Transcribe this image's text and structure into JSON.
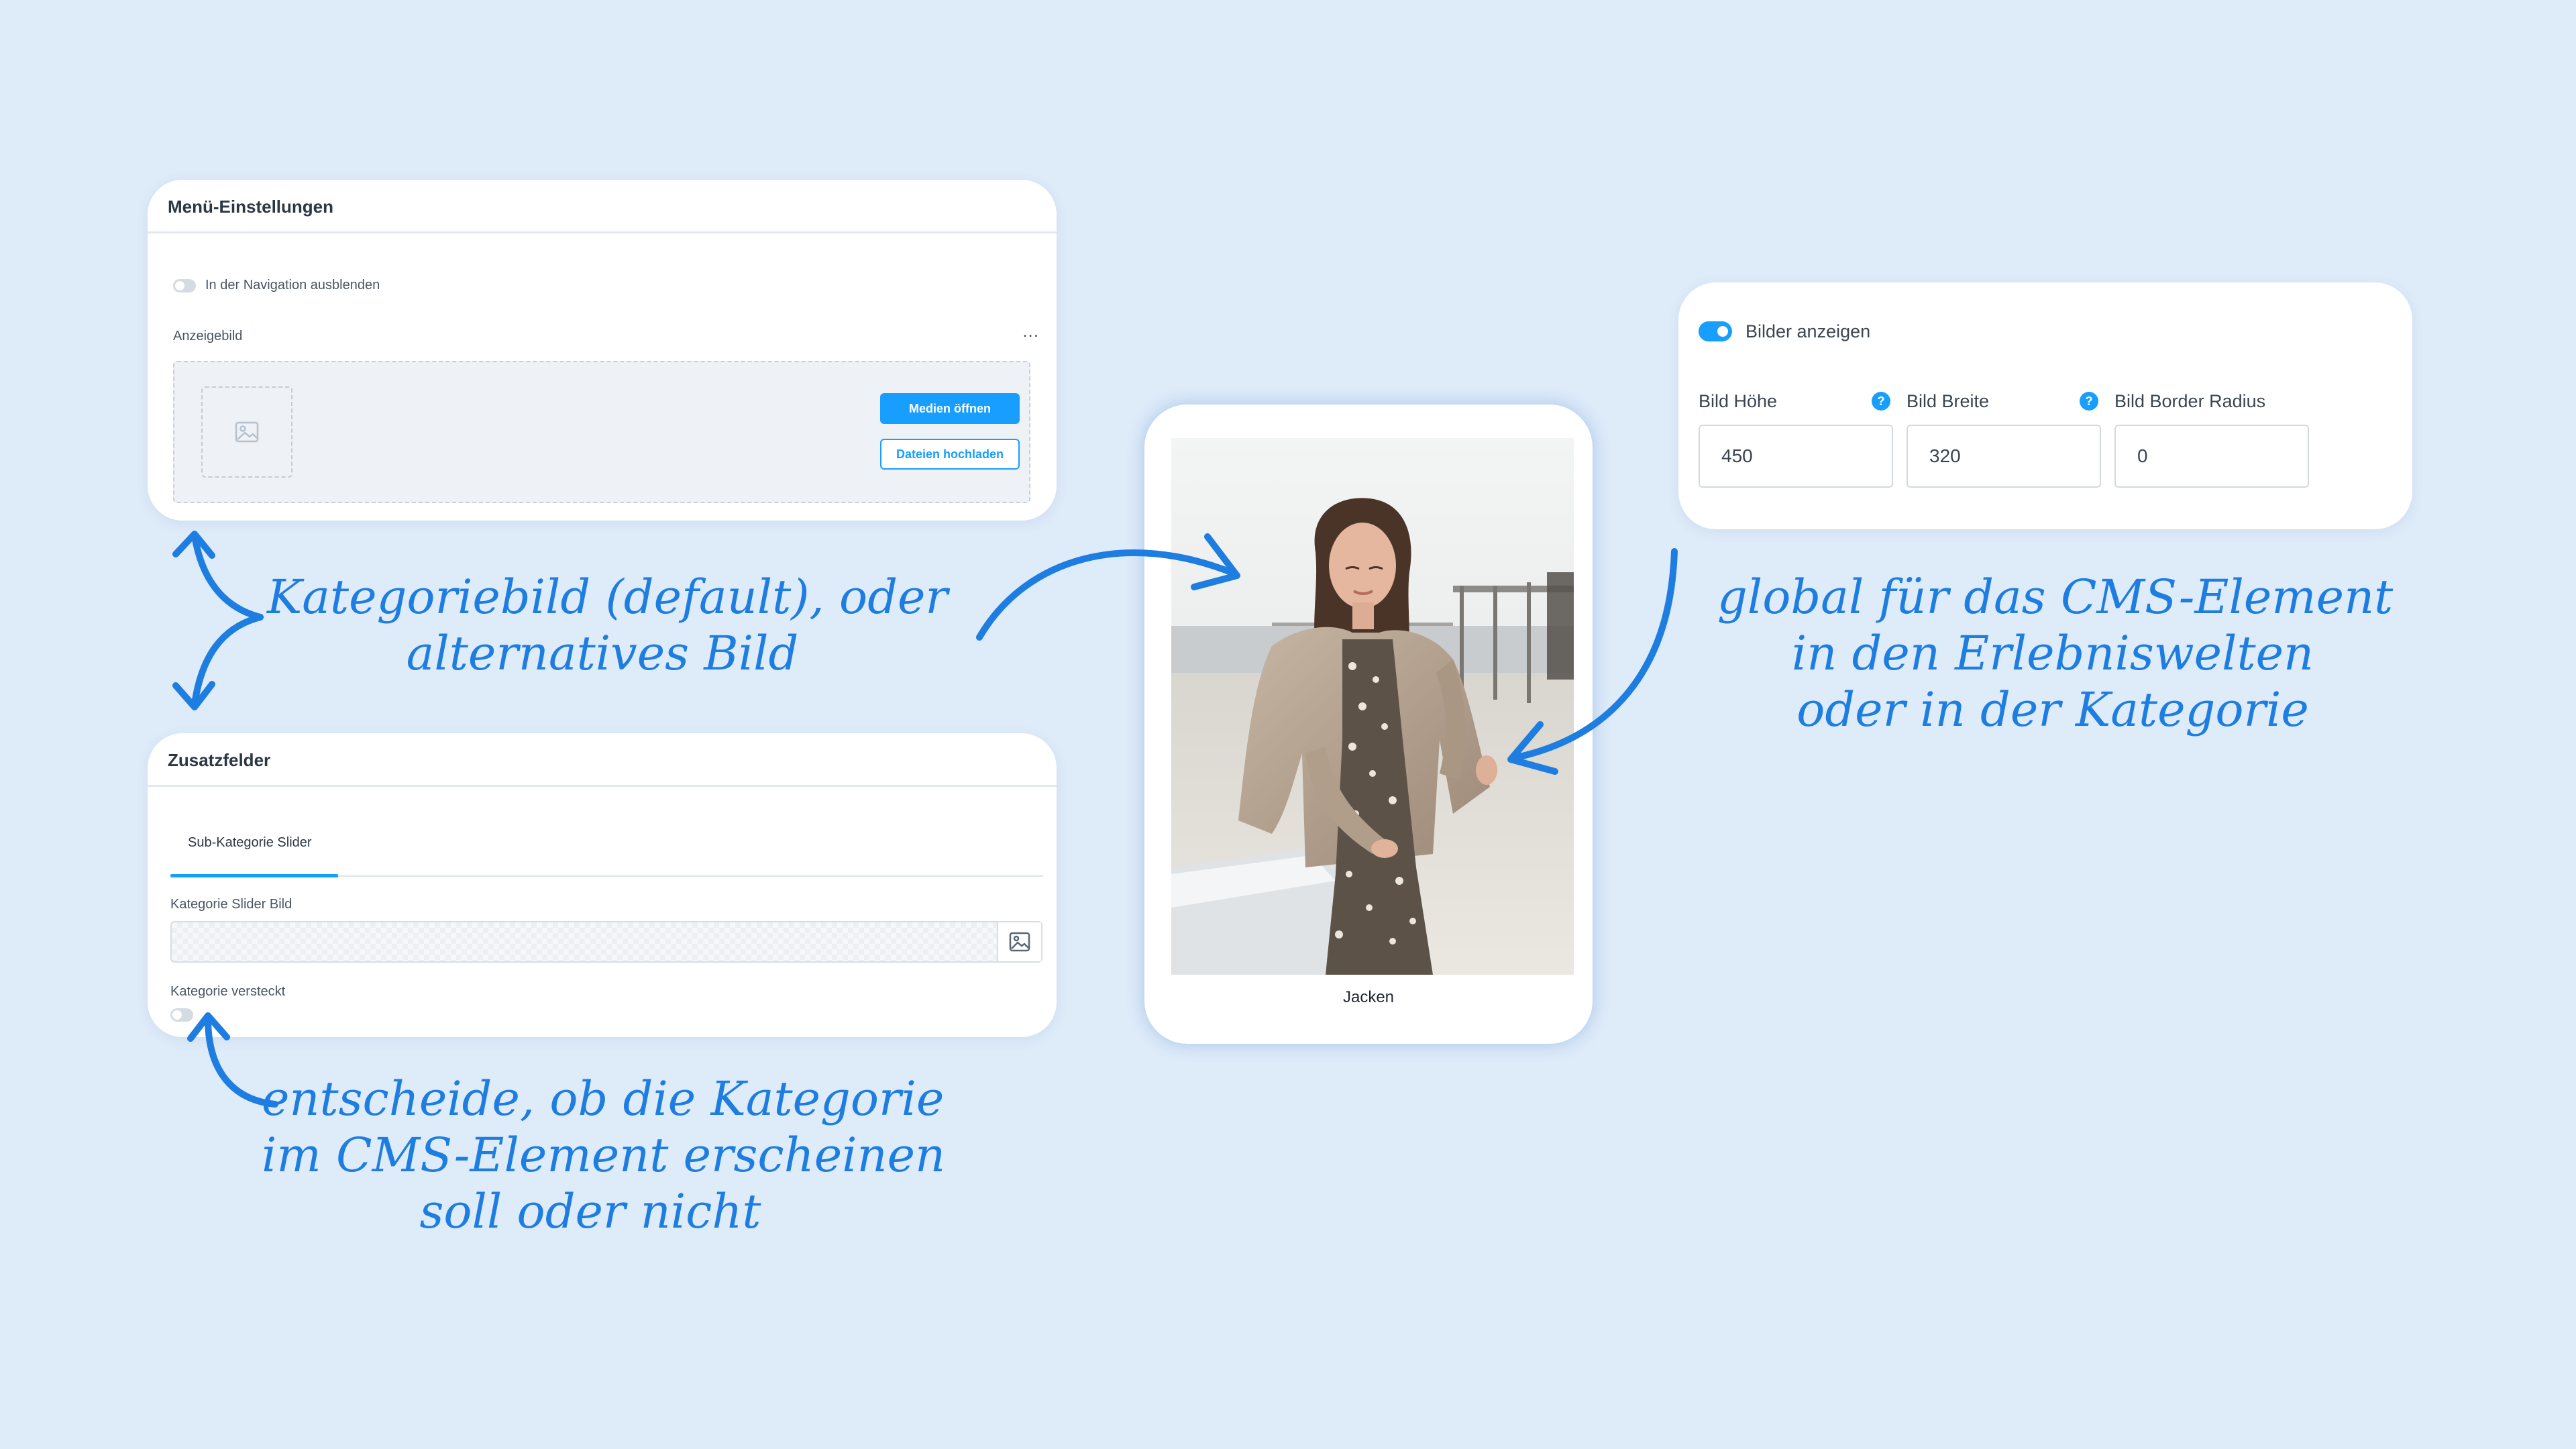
{
  "menu_card": {
    "title": "Menü-Einstellungen",
    "toggle_label": "In der Navigation ausblenden",
    "image_label": "Anzeigebild",
    "more_label": "...",
    "open_media_button": "Medien öffnen",
    "upload_button": "Dateien hochladen"
  },
  "zusatz_card": {
    "title": "Zusatzfelder",
    "tab_label": "Sub-Kategorie Slider",
    "slider_image_label": "Kategorie Slider Bild",
    "hidden_label": "Kategorie versteckt"
  },
  "preview_card": {
    "caption": "Jacken"
  },
  "bilder_card": {
    "toggle_label": "Bilder anzeigen",
    "toggle_on": true,
    "fields": [
      {
        "label": "Bild Höhe",
        "value": "450"
      },
      {
        "label": "Bild Breite",
        "value": "320"
      },
      {
        "label": "Bild Border Radius",
        "value": "0"
      }
    ],
    "help_icon": "?"
  },
  "notes": {
    "kategoriebild_line1": "Kategoriebild (default), oder",
    "kategoriebild_line2": "alternatives Bild",
    "global_line1": "global für das CMS-Element",
    "global_line2": "in den Erlebniswelten",
    "global_line3": "oder in der Kategorie",
    "entscheide_line1": "entscheide, ob die Kategorie",
    "entscheide_line2": "im CMS-Element erscheinen",
    "entscheide_line3": "soll oder nicht"
  },
  "colors": {
    "background": "#deebf9",
    "accent": "#189eff",
    "annotation": "#1e7de0"
  }
}
